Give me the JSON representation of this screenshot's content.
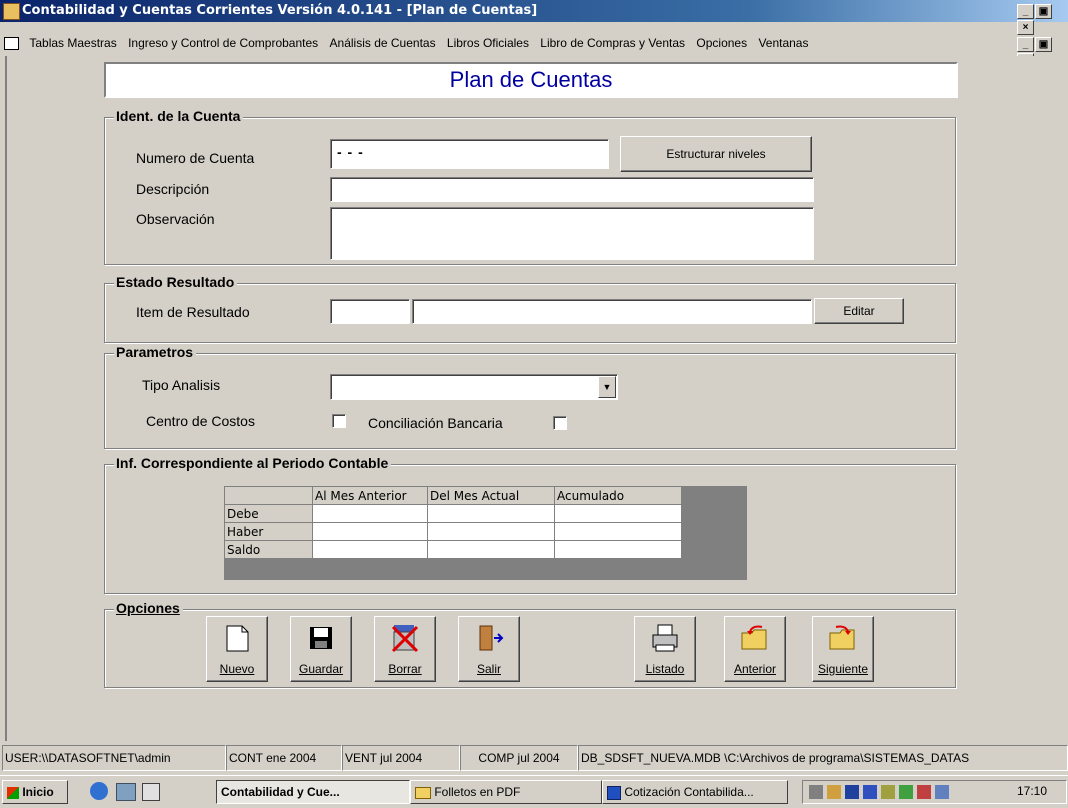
{
  "window": {
    "title": "Contabilidad y Cuentas Corrientes  Versión 4.0.141 - [Plan de Cuentas]"
  },
  "menu": [
    "Tablas Maestras",
    "Ingreso y Control de Comprobantes",
    "Análisis de Cuentas",
    "Libros Oficiales",
    "Libro de Compras y Ventas",
    "Opciones",
    "Ventanas"
  ],
  "form": {
    "title": "Plan de Cuentas",
    "ident": {
      "title": "Ident. de la Cuenta",
      "numero_label": "Numero de Cuenta",
      "numero_value": "- -  -",
      "estructurar_button": "Estructurar niveles",
      "descripcion_label": "Descripción",
      "descripcion_value": "",
      "observacion_label": "Observación",
      "observacion_value": ""
    },
    "estado": {
      "title": "Estado Resultado",
      "item_label": "Item de Resultado",
      "item_code": "",
      "item_desc": "",
      "editar_button": "Editar"
    },
    "parametros": {
      "title": "Parametros",
      "tipo_label": "Tipo Analisis",
      "tipo_value": "",
      "centro_label": "Centro de Costos",
      "centro_checked": false,
      "conciliacion_label": "Conciliación Bancaria",
      "conciliacion_checked": false
    },
    "periodo": {
      "title": "Inf. Correspondiente al Periodo Contable",
      "columns": [
        "Al Mes Anterior",
        "Del Mes Actual",
        "Acumulado"
      ],
      "rows": [
        {
          "label": "Debe",
          "values": [
            "",
            "",
            ""
          ]
        },
        {
          "label": "Haber",
          "values": [
            "",
            "",
            ""
          ]
        },
        {
          "label": "Saldo",
          "values": [
            "",
            "",
            ""
          ]
        }
      ]
    },
    "opciones": {
      "title": "Opciones",
      "buttons": {
        "nuevo": "Nuevo",
        "guardar": "Guardar",
        "borrar": "Borrar",
        "salir": "Salir",
        "listado": "Listado",
        "anterior": "Anterior",
        "siguiente": "Siguiente"
      }
    }
  },
  "status": {
    "user": "USER:\\\\DATASOFTNET\\admin",
    "cont": "CONT ene 2004",
    "vent": "VENT jul 2004",
    "comp": "COMP jul 2004",
    "db": "DB_SDSFT_NUEVA.MDB \\C:\\Archivos de programa\\SISTEMAS_DATAS"
  },
  "taskbar": {
    "start": "Inicio",
    "tasks": [
      "Contabilidad y Cue...",
      "Folletos en PDF",
      "Cotización Contabilida..."
    ],
    "clock": "17:10"
  }
}
